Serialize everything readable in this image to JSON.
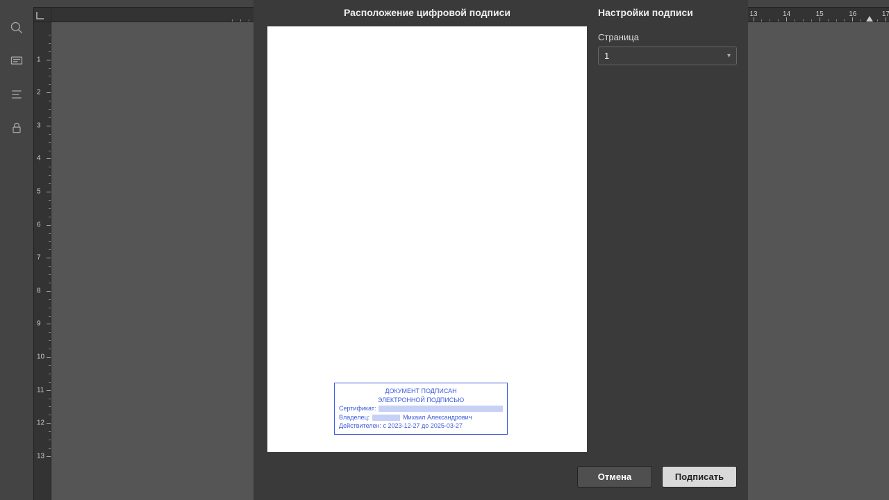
{
  "dialog": {
    "left_title": "Расположение цифровой подписи",
    "right_title": "Настройки подписи",
    "page_label": "Страница",
    "page_value": "1",
    "cancel": "Отмена",
    "sign": "Подписать"
  },
  "signature": {
    "line1": "ДОКУМЕНТ ПОДПИСАН",
    "line2": "ЭЛЕКТРОННОЙ ПОДПИСЬЮ",
    "cert_label": "Сертификат:",
    "owner_label": "Владелец:",
    "owner_name": "Михаил Александрович",
    "valid_label": "Действителен: c 2023-12-27 до 2025-03-27"
  },
  "top_ruler_visible": [
    "13",
    "14",
    "15",
    "16",
    "17"
  ],
  "left_ruler": [
    "1",
    "2",
    "3",
    "4",
    "5",
    "6",
    "7",
    "8",
    "9",
    "10",
    "11",
    "12",
    "13"
  ]
}
